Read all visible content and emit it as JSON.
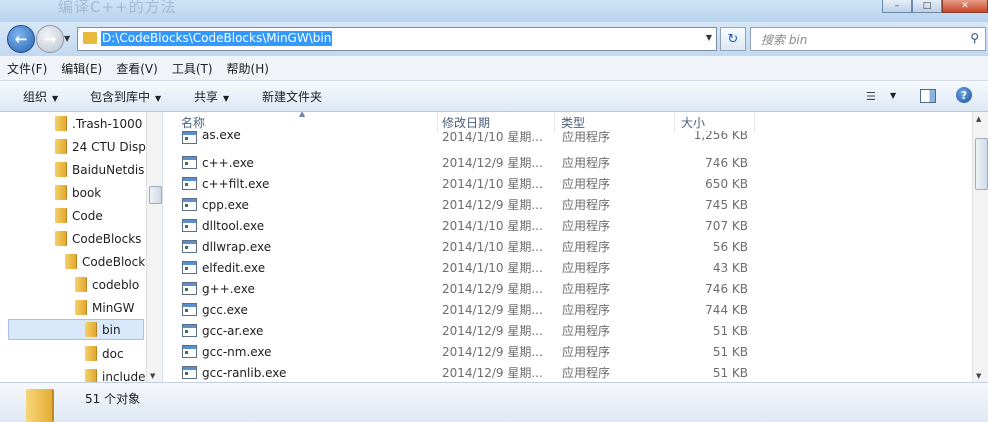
{
  "window": {
    "ghost_title": "编译C++的方法",
    "buttons": {
      "minimize": "–",
      "maximize": "□",
      "close": "✕"
    }
  },
  "address": {
    "path": "D:\\CodeBlocks\\CodeBlocks\\MinGW\\bin",
    "search_placeholder": "搜索 bin"
  },
  "menu": [
    "文件(F)",
    "编辑(E)",
    "查看(V)",
    "工具(T)",
    "帮助(H)"
  ],
  "commands": {
    "organize": "组织",
    "include_library": "包含到库中",
    "share": "共享",
    "new_folder": "新建文件夹"
  },
  "tree": [
    {
      "label": ".Trash-1000"
    },
    {
      "label": "24 CTU Disp"
    },
    {
      "label": "BaiduNetdis"
    },
    {
      "label": "book"
    },
    {
      "label": "Code"
    },
    {
      "label": "CodeBlocks"
    },
    {
      "label": "CodeBlock"
    },
    {
      "label": "codeblo"
    },
    {
      "label": "MinGW"
    },
    {
      "label": "bin"
    },
    {
      "label": "doc"
    },
    {
      "label": "include"
    }
  ],
  "columns": {
    "name": "名称",
    "date": "修改日期",
    "type": "类型",
    "size": "大小"
  },
  "files": [
    {
      "name": "as.exe",
      "date": "2014/1/10 星期...",
      "type": "应用程序",
      "size": "1,256 KB"
    },
    {
      "name": "c++.exe",
      "date": "2014/12/9 星期...",
      "type": "应用程序",
      "size": "746 KB"
    },
    {
      "name": "c++filt.exe",
      "date": "2014/1/10 星期...",
      "type": "应用程序",
      "size": "650 KB"
    },
    {
      "name": "cpp.exe",
      "date": "2014/12/9 星期...",
      "type": "应用程序",
      "size": "745 KB"
    },
    {
      "name": "dlltool.exe",
      "date": "2014/1/10 星期...",
      "type": "应用程序",
      "size": "707 KB"
    },
    {
      "name": "dllwrap.exe",
      "date": "2014/1/10 星期...",
      "type": "应用程序",
      "size": "56 KB"
    },
    {
      "name": "elfedit.exe",
      "date": "2014/1/10 星期...",
      "type": "应用程序",
      "size": "43 KB"
    },
    {
      "name": "g++.exe",
      "date": "2014/12/9 星期...",
      "type": "应用程序",
      "size": "746 KB"
    },
    {
      "name": "gcc.exe",
      "date": "2014/12/9 星期...",
      "type": "应用程序",
      "size": "744 KB"
    },
    {
      "name": "gcc-ar.exe",
      "date": "2014/12/9 星期...",
      "type": "应用程序",
      "size": "51 KB"
    },
    {
      "name": "gcc-nm.exe",
      "date": "2014/12/9 星期...",
      "type": "应用程序",
      "size": "51 KB"
    },
    {
      "name": "gcc-ranlib.exe",
      "date": "2014/12/9 星期...",
      "type": "应用程序",
      "size": "51 KB"
    }
  ],
  "status": {
    "count": "51 个对象"
  }
}
